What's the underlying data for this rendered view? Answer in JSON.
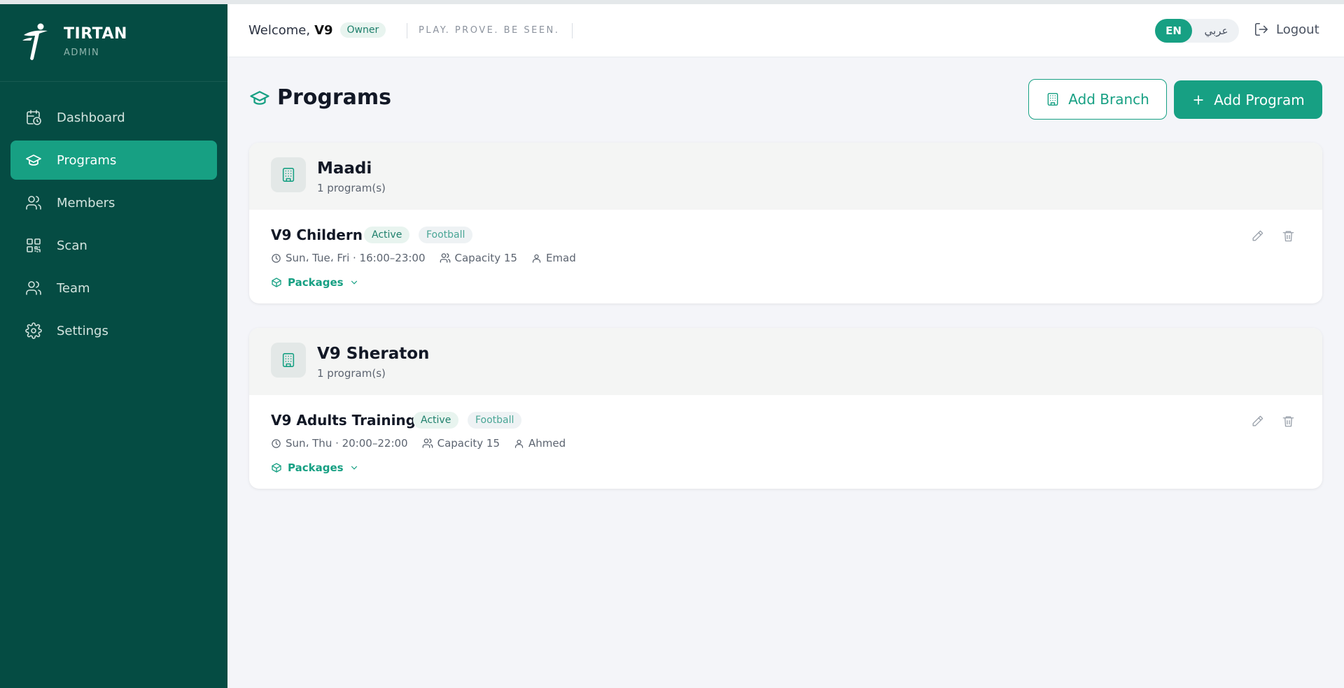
{
  "app": {
    "name": "TIRTAN",
    "subtitle": "ADMIN"
  },
  "sidebar": {
    "items": [
      {
        "label": "Dashboard",
        "icon": "calendar-clock-icon",
        "active": false
      },
      {
        "label": "Programs",
        "icon": "graduation-cap-icon",
        "active": true
      },
      {
        "label": "Members",
        "icon": "users-icon",
        "active": false
      },
      {
        "label": "Scan",
        "icon": "qr-code-icon",
        "active": false
      },
      {
        "label": "Team",
        "icon": "users-icon",
        "active": false
      },
      {
        "label": "Settings",
        "icon": "gear-icon",
        "active": false
      }
    ]
  },
  "header": {
    "welcome_prefix": "Welcome,",
    "user_name": "V9",
    "role": "Owner",
    "tagline": "PLAY. PROVE. BE SEEN.",
    "lang_en": "EN",
    "lang_ar": "عربي",
    "logout": "Logout"
  },
  "page": {
    "title": "Programs",
    "add_branch": "Add Branch",
    "add_program": "Add Program"
  },
  "branches": [
    {
      "name": "Maadi",
      "count": "1 program(s)",
      "programs": [
        {
          "name": "V9 Childern",
          "status": "Active",
          "sport": "Football",
          "schedule": "Sun، Tue، Fri · 16:00–23:00",
          "capacity": "Capacity 15",
          "coach": "Emad",
          "packages": "Packages"
        }
      ]
    },
    {
      "name": "V9 Sheraton",
      "count": "1 program(s)",
      "programs": [
        {
          "name": "V9 Adults Training",
          "status": "Active",
          "sport": "Football",
          "schedule": "Sun، Thu · 20:00–22:00",
          "capacity": "Capacity 15",
          "coach": "Ahmed",
          "packages": "Packages"
        }
      ]
    }
  ],
  "colors": {
    "sidebar_bg": "#054c43",
    "accent": "#17a083",
    "page_bg": "#f4f5f9"
  }
}
